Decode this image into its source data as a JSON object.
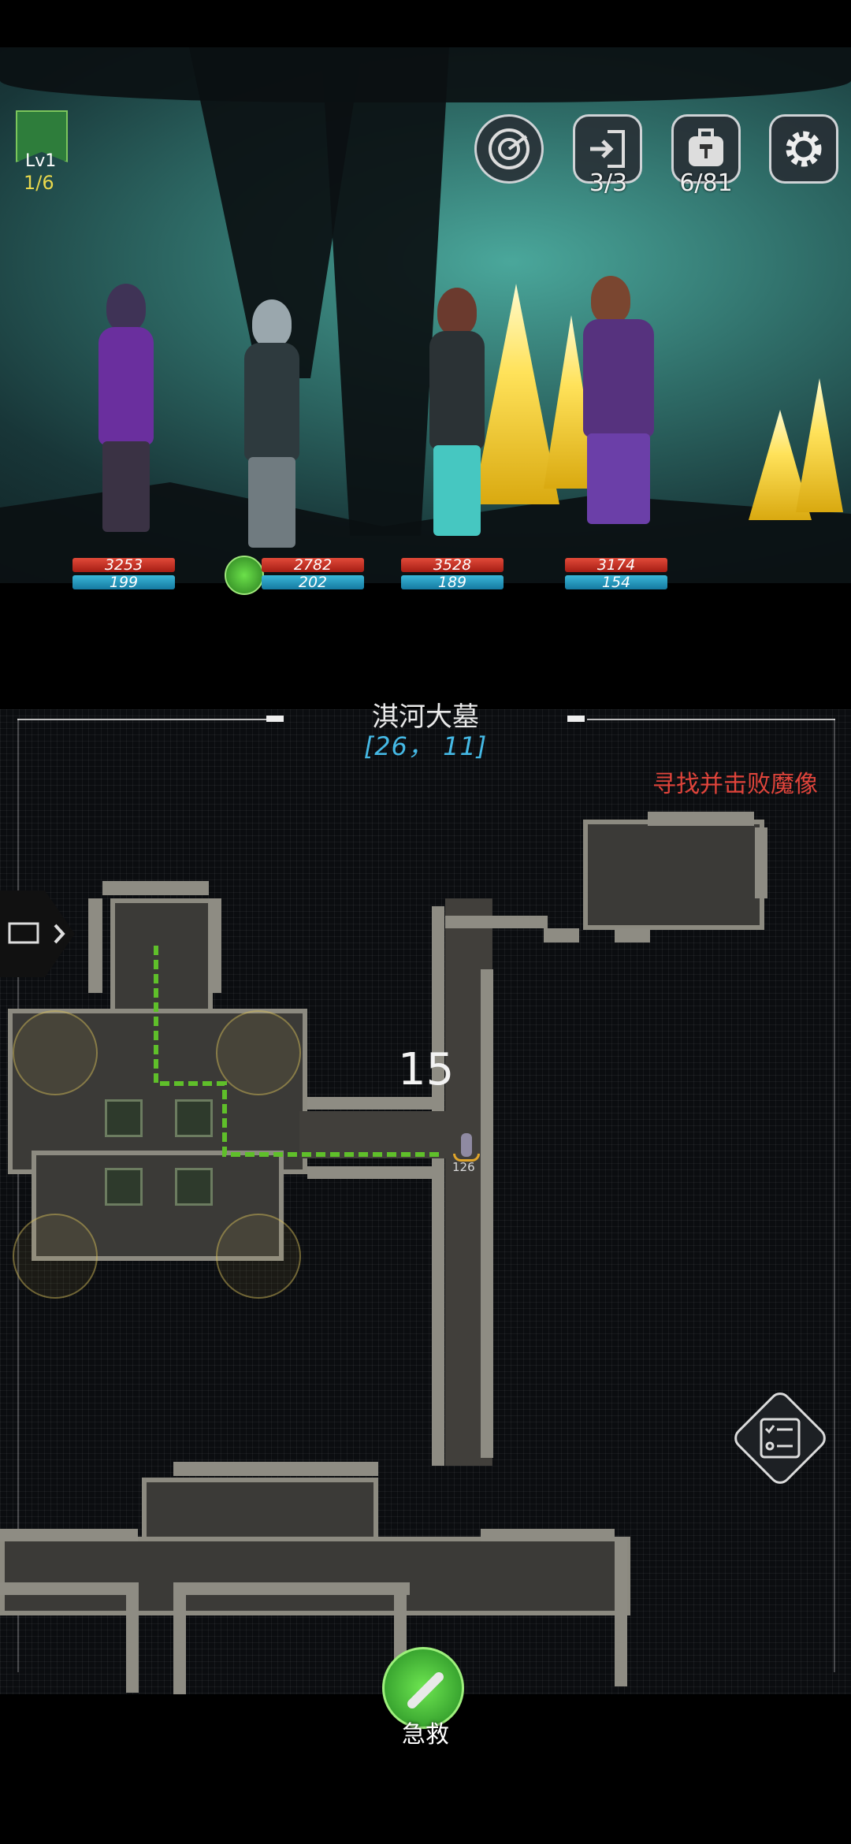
{
  "player": {
    "level": "Lv1",
    "progress": "1/6"
  },
  "top_buttons": [
    {
      "name": "radar",
      "icon": "radar-icon",
      "count": ""
    },
    {
      "name": "exit",
      "icon": "exit-door-icon",
      "count": "3/3"
    },
    {
      "name": "bag",
      "icon": "backpack-icon",
      "count": "6/81"
    },
    {
      "name": "settings",
      "icon": "gear-icon",
      "count": ""
    }
  ],
  "party": [
    {
      "hp": "3253",
      "mp": "199",
      "hp_fill": 0.95,
      "mp_fill": 0.95
    },
    {
      "hp": "2782",
      "mp": "202",
      "hp_fill": 0.92,
      "mp_fill": 1.0,
      "status_icon": "syringe-buff-icon"
    },
    {
      "hp": "3528",
      "mp": "189",
      "hp_fill": 0.88,
      "mp_fill": 1.0
    },
    {
      "hp": "3174",
      "mp": "154",
      "hp_fill": 0.88,
      "mp_fill": 0.92
    }
  ],
  "map": {
    "title": "淇河大墓",
    "coords": "[26， 11]",
    "quest": "寻找并击败魔像",
    "step_count": "15",
    "marker_label": "126"
  },
  "side_buttons": {
    "chat_icon": "chat-bubbles-icon",
    "tasks_icon": "checklist-icon"
  },
  "rescue": {
    "label": "急救",
    "icon": "medkit-syringe-icon"
  },
  "colors": {
    "hp": "#d33a2c",
    "mp": "#2aa7cf",
    "quest": "#e0443b",
    "coords": "#45b9e5",
    "path": "#5fbf2a"
  }
}
